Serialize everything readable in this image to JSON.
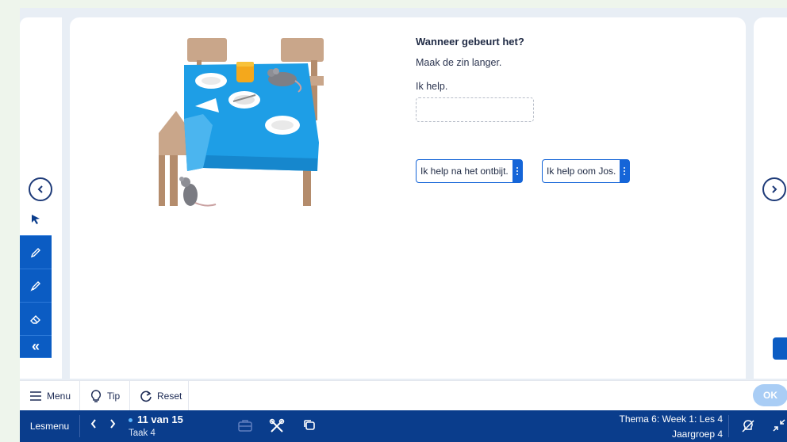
{
  "exercise": {
    "question": "Wanneer gebeurt het?",
    "instruction": "Maak de zin langer.",
    "base_sentence": "Ik help.",
    "options": [
      "Ik help na het ontbijt.",
      "Ik help oom Jos."
    ]
  },
  "toolbar": {
    "menu_label": "Menu",
    "tip_label": "Tip",
    "reset_label": "Reset",
    "ok_label": "OK"
  },
  "bottombar": {
    "lesmenu_label": "Lesmenu",
    "progress": "11 van 15",
    "task": "Taak 4",
    "week": "Thema 6: Week 1: Les 4",
    "group": "Jaargroep 4"
  },
  "colors": {
    "primary": "#0b5cc3",
    "navy": "#0a3d8c",
    "tablecloth": "#1e9ee6",
    "ok_disabled": "#a9cdf5"
  },
  "icons": [
    "chevron-left-icon",
    "chevron-right-icon",
    "pointer-icon",
    "pencil-icon",
    "marker-icon",
    "eraser-icon",
    "double-chevron-left-icon",
    "menu-icon",
    "lightbulb-icon",
    "reset-icon",
    "briefcase-icon",
    "tools-icon",
    "copy-icon",
    "hide-icon",
    "collapse-icon"
  ]
}
